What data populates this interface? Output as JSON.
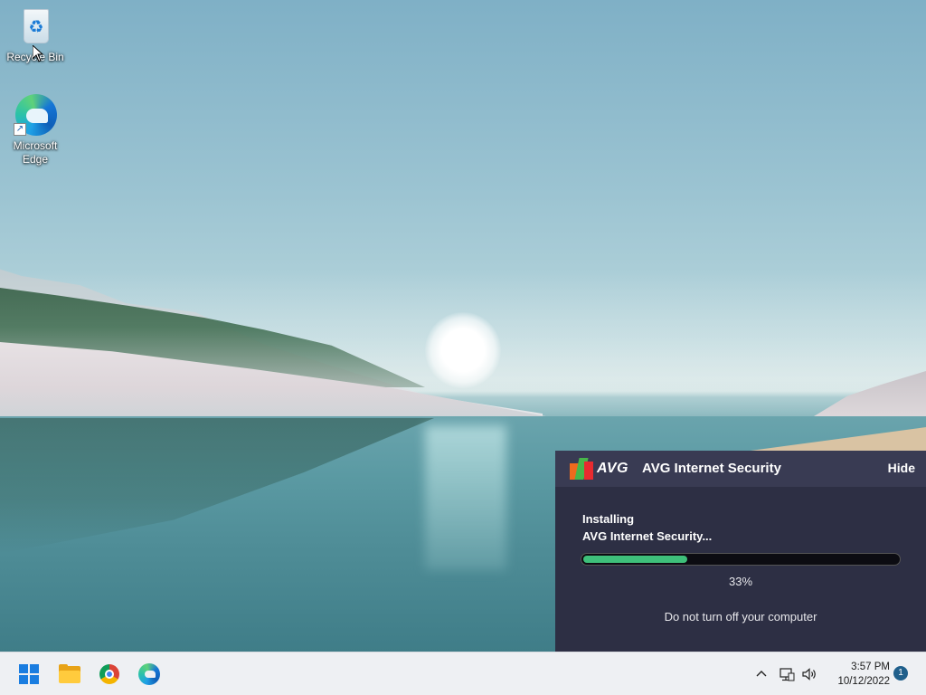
{
  "desktop": {
    "icons": [
      {
        "label": "Recycle Bin",
        "icon": "recycle-bin-icon"
      },
      {
        "label": "Microsoft Edge",
        "icon": "edge-icon"
      }
    ]
  },
  "avg_installer": {
    "logo_text": "AVG",
    "title": "AVG Internet Security",
    "hide_label": "Hide",
    "status_line1": "Installing",
    "status_line2": "AVG Internet Security...",
    "progress_fraction": 0.33,
    "progress_text": "33%",
    "notice": "Do not turn off your computer",
    "colors": {
      "panel_bg": "#2d2f44",
      "header_bg": "#393b53",
      "progress_fill": "#3ec07a"
    }
  },
  "taskbar": {
    "apps": [
      {
        "name": "Start",
        "icon": "windows-start-icon"
      },
      {
        "name": "File Explorer",
        "icon": "folder-icon"
      },
      {
        "name": "Google Chrome",
        "icon": "chrome-icon"
      },
      {
        "name": "Microsoft Edge",
        "icon": "edge-icon"
      }
    ],
    "tray": {
      "chevron_icon": "chevron-up-icon",
      "network_icon": "network-icon",
      "volume_icon": "volume-icon",
      "time": "3:57 PM",
      "date": "10/12/2022",
      "notification_count": "1"
    }
  }
}
